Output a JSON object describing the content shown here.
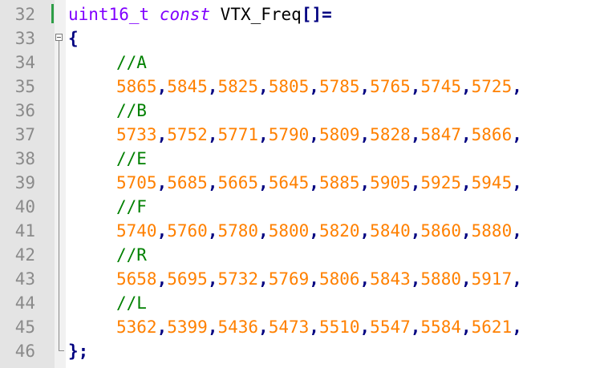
{
  "editor": {
    "lines": [
      {
        "num": "32",
        "tokens": [
          {
            "t": "uint16_t",
            "c": "kw-type"
          },
          {
            "t": " ",
            "c": "ident"
          },
          {
            "t": "const",
            "c": "kw-const"
          },
          {
            "t": " VTX_Freq",
            "c": "ident"
          },
          {
            "t": "[]=",
            "c": "op"
          }
        ]
      },
      {
        "num": "33",
        "tokens": [
          {
            "t": "{",
            "c": "op"
          }
        ]
      },
      {
        "num": "34",
        "tokens": [
          {
            "t": "//A",
            "c": "comment"
          }
        ],
        "indent": true
      },
      {
        "num": "35",
        "indent": true,
        "values": [
          "5865",
          "5845",
          "5825",
          "5805",
          "5785",
          "5765",
          "5745",
          "5725"
        ]
      },
      {
        "num": "36",
        "tokens": [
          {
            "t": "//B",
            "c": "comment"
          }
        ],
        "indent": true
      },
      {
        "num": "37",
        "indent": true,
        "values": [
          "5733",
          "5752",
          "5771",
          "5790",
          "5809",
          "5828",
          "5847",
          "5866"
        ]
      },
      {
        "num": "38",
        "tokens": [
          {
            "t": "//E",
            "c": "comment"
          }
        ],
        "indent": true
      },
      {
        "num": "39",
        "indent": true,
        "values": [
          "5705",
          "5685",
          "5665",
          "5645",
          "5885",
          "5905",
          "5925",
          "5945"
        ]
      },
      {
        "num": "40",
        "tokens": [
          {
            "t": "//F",
            "c": "comment"
          }
        ],
        "indent": true
      },
      {
        "num": "41",
        "indent": true,
        "values": [
          "5740",
          "5760",
          "5780",
          "5800",
          "5820",
          "5840",
          "5860",
          "5880"
        ]
      },
      {
        "num": "42",
        "tokens": [
          {
            "t": "//R",
            "c": "comment"
          }
        ],
        "indent": true
      },
      {
        "num": "43",
        "indent": true,
        "values": [
          "5658",
          "5695",
          "5732",
          "5769",
          "5806",
          "5843",
          "5880",
          "5917"
        ]
      },
      {
        "num": "44",
        "tokens": [
          {
            "t": "//L",
            "c": "comment"
          }
        ],
        "indent": true
      },
      {
        "num": "45",
        "indent": true,
        "values": [
          "5362",
          "5399",
          "5436",
          "5473",
          "5510",
          "5547",
          "5584",
          "5621"
        ]
      },
      {
        "num": "46",
        "tokens": [
          {
            "t": "};",
            "c": "op"
          }
        ]
      }
    ]
  },
  "colors": {
    "keyword": "#8000ff",
    "operator": "#000080",
    "comment": "#008000",
    "number": "#ff8000",
    "line_number": "#8a8a8a",
    "change_bar": "#2e9e47"
  },
  "icons": {
    "fold": "fold-minus-icon",
    "fold_end": "fold-end-icon"
  }
}
